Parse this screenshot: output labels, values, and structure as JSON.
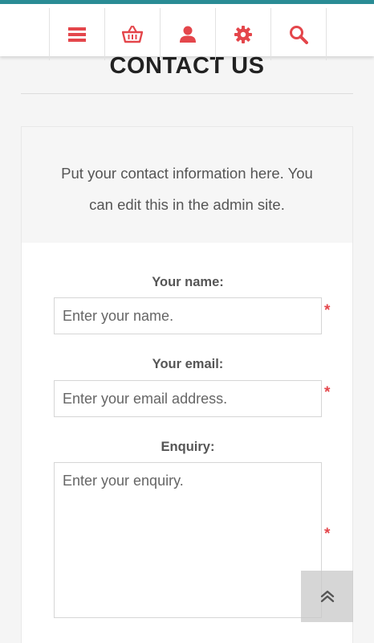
{
  "colors": {
    "accent": "#e4464b",
    "topbar_stripe": "#2a8c95",
    "icon": "#e4464b"
  },
  "header": {
    "nav": [
      {
        "name": "menu",
        "icon": "hamburger-icon"
      },
      {
        "name": "cart",
        "icon": "basket-icon"
      },
      {
        "name": "account",
        "icon": "user-icon"
      },
      {
        "name": "settings",
        "icon": "gear-icon"
      },
      {
        "name": "search",
        "icon": "search-icon"
      }
    ]
  },
  "page": {
    "title": "CONTACT US",
    "info_text": "Put your contact information here. You can edit this in the admin site."
  },
  "form": {
    "name": {
      "label": "Your name:",
      "placeholder": "Enter your name.",
      "required_mark": "*"
    },
    "email": {
      "label": "Your email:",
      "placeholder": "Enter your email address.",
      "required_mark": "*"
    },
    "enquiry": {
      "label": "Enquiry:",
      "placeholder": "Enter your enquiry.",
      "required_mark": "*"
    }
  },
  "scroll_top": {
    "icon": "double-chevron-up-icon"
  }
}
